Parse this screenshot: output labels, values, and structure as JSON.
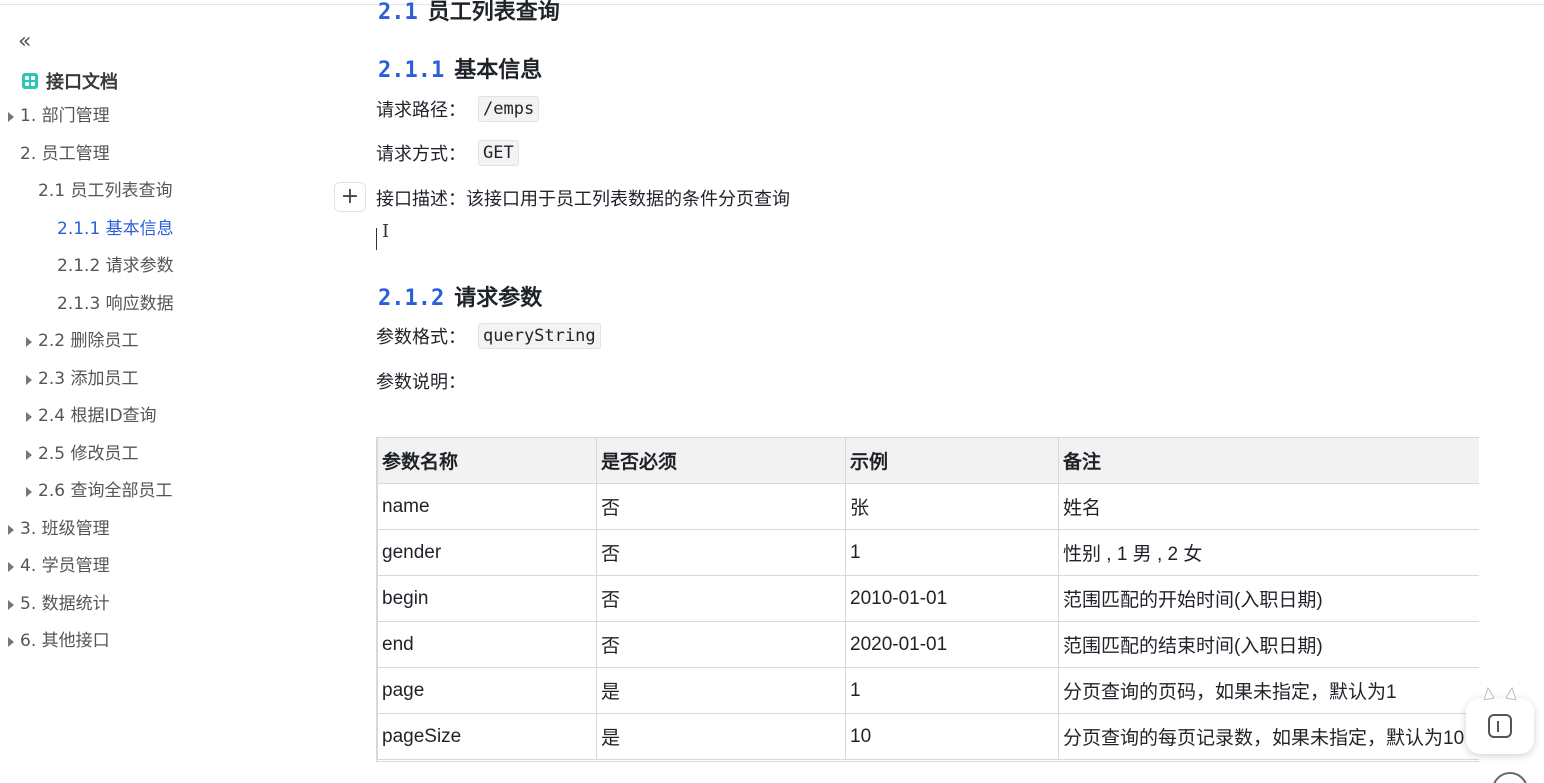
{
  "sidebar": {
    "collapse_glyph": "«",
    "doc_title": "接口文档",
    "items": [
      {
        "label": "1. 部门管理",
        "caret": true
      },
      {
        "label": "2. 员工管理",
        "caret": false
      },
      {
        "label": "2.1 员工列表查询",
        "caret": false
      },
      {
        "label": "2.1.1 基本信息",
        "caret": false,
        "active": true
      },
      {
        "label": "2.1.2 请求参数",
        "caret": false
      },
      {
        "label": "2.1.3 响应数据",
        "caret": false
      },
      {
        "label": "2.2 删除员工",
        "caret": true
      },
      {
        "label": "2.3 添加员工",
        "caret": true
      },
      {
        "label": "2.4 根据ID查询",
        "caret": true
      },
      {
        "label": "2.5 修改员工",
        "caret": true
      },
      {
        "label": "2.6 查询全部员工",
        "caret": true
      },
      {
        "label": "3. 班级管理",
        "caret": true
      },
      {
        "label": "4. 学员管理",
        "caret": true
      },
      {
        "label": "5. 数据统计",
        "caret": true
      },
      {
        "label": "6. 其他接口",
        "caret": true
      }
    ],
    "active_color": "#2b5fd9"
  },
  "main": {
    "top_heading": {
      "num": "2.1",
      "text": "员工列表查询"
    },
    "basic_info": {
      "heading_num": "2.1.1",
      "heading_text": "基本信息",
      "path_label": "请求路径：",
      "path_value": "/emps",
      "method_label": "请求方式：",
      "method_value": "GET",
      "desc_label": "接口描述：",
      "desc_value": "该接口用于员工列表数据的条件分页查询"
    },
    "add_block_glyph": "+",
    "ibeam_glyph": "I",
    "request_params": {
      "heading_num": "2.1.2",
      "heading_text": "请求参数",
      "format_label": "参数格式：",
      "format_value": "queryString",
      "desc_label": "参数说明："
    },
    "table": {
      "headers": [
        "参数名称",
        "是否必须",
        "示例",
        "备注"
      ],
      "rows": [
        [
          "name",
          "否",
          "张",
          "姓名"
        ],
        [
          "gender",
          "否",
          "1",
          "性别 , 1 男 , 2 女"
        ],
        [
          "begin",
          "否",
          "2010-01-01",
          "范围匹配的开始时间(入职日期)"
        ],
        [
          "end",
          "否",
          "2020-01-01",
          "范围匹配的结束时间(入职日期)"
        ],
        [
          "page",
          "是",
          "1",
          "分页查询的页码，如果未指定，默认为1"
        ],
        [
          "pageSize",
          "是",
          "10",
          "分页查询的每页记录数，如果未指定，默认为10"
        ]
      ]
    }
  }
}
